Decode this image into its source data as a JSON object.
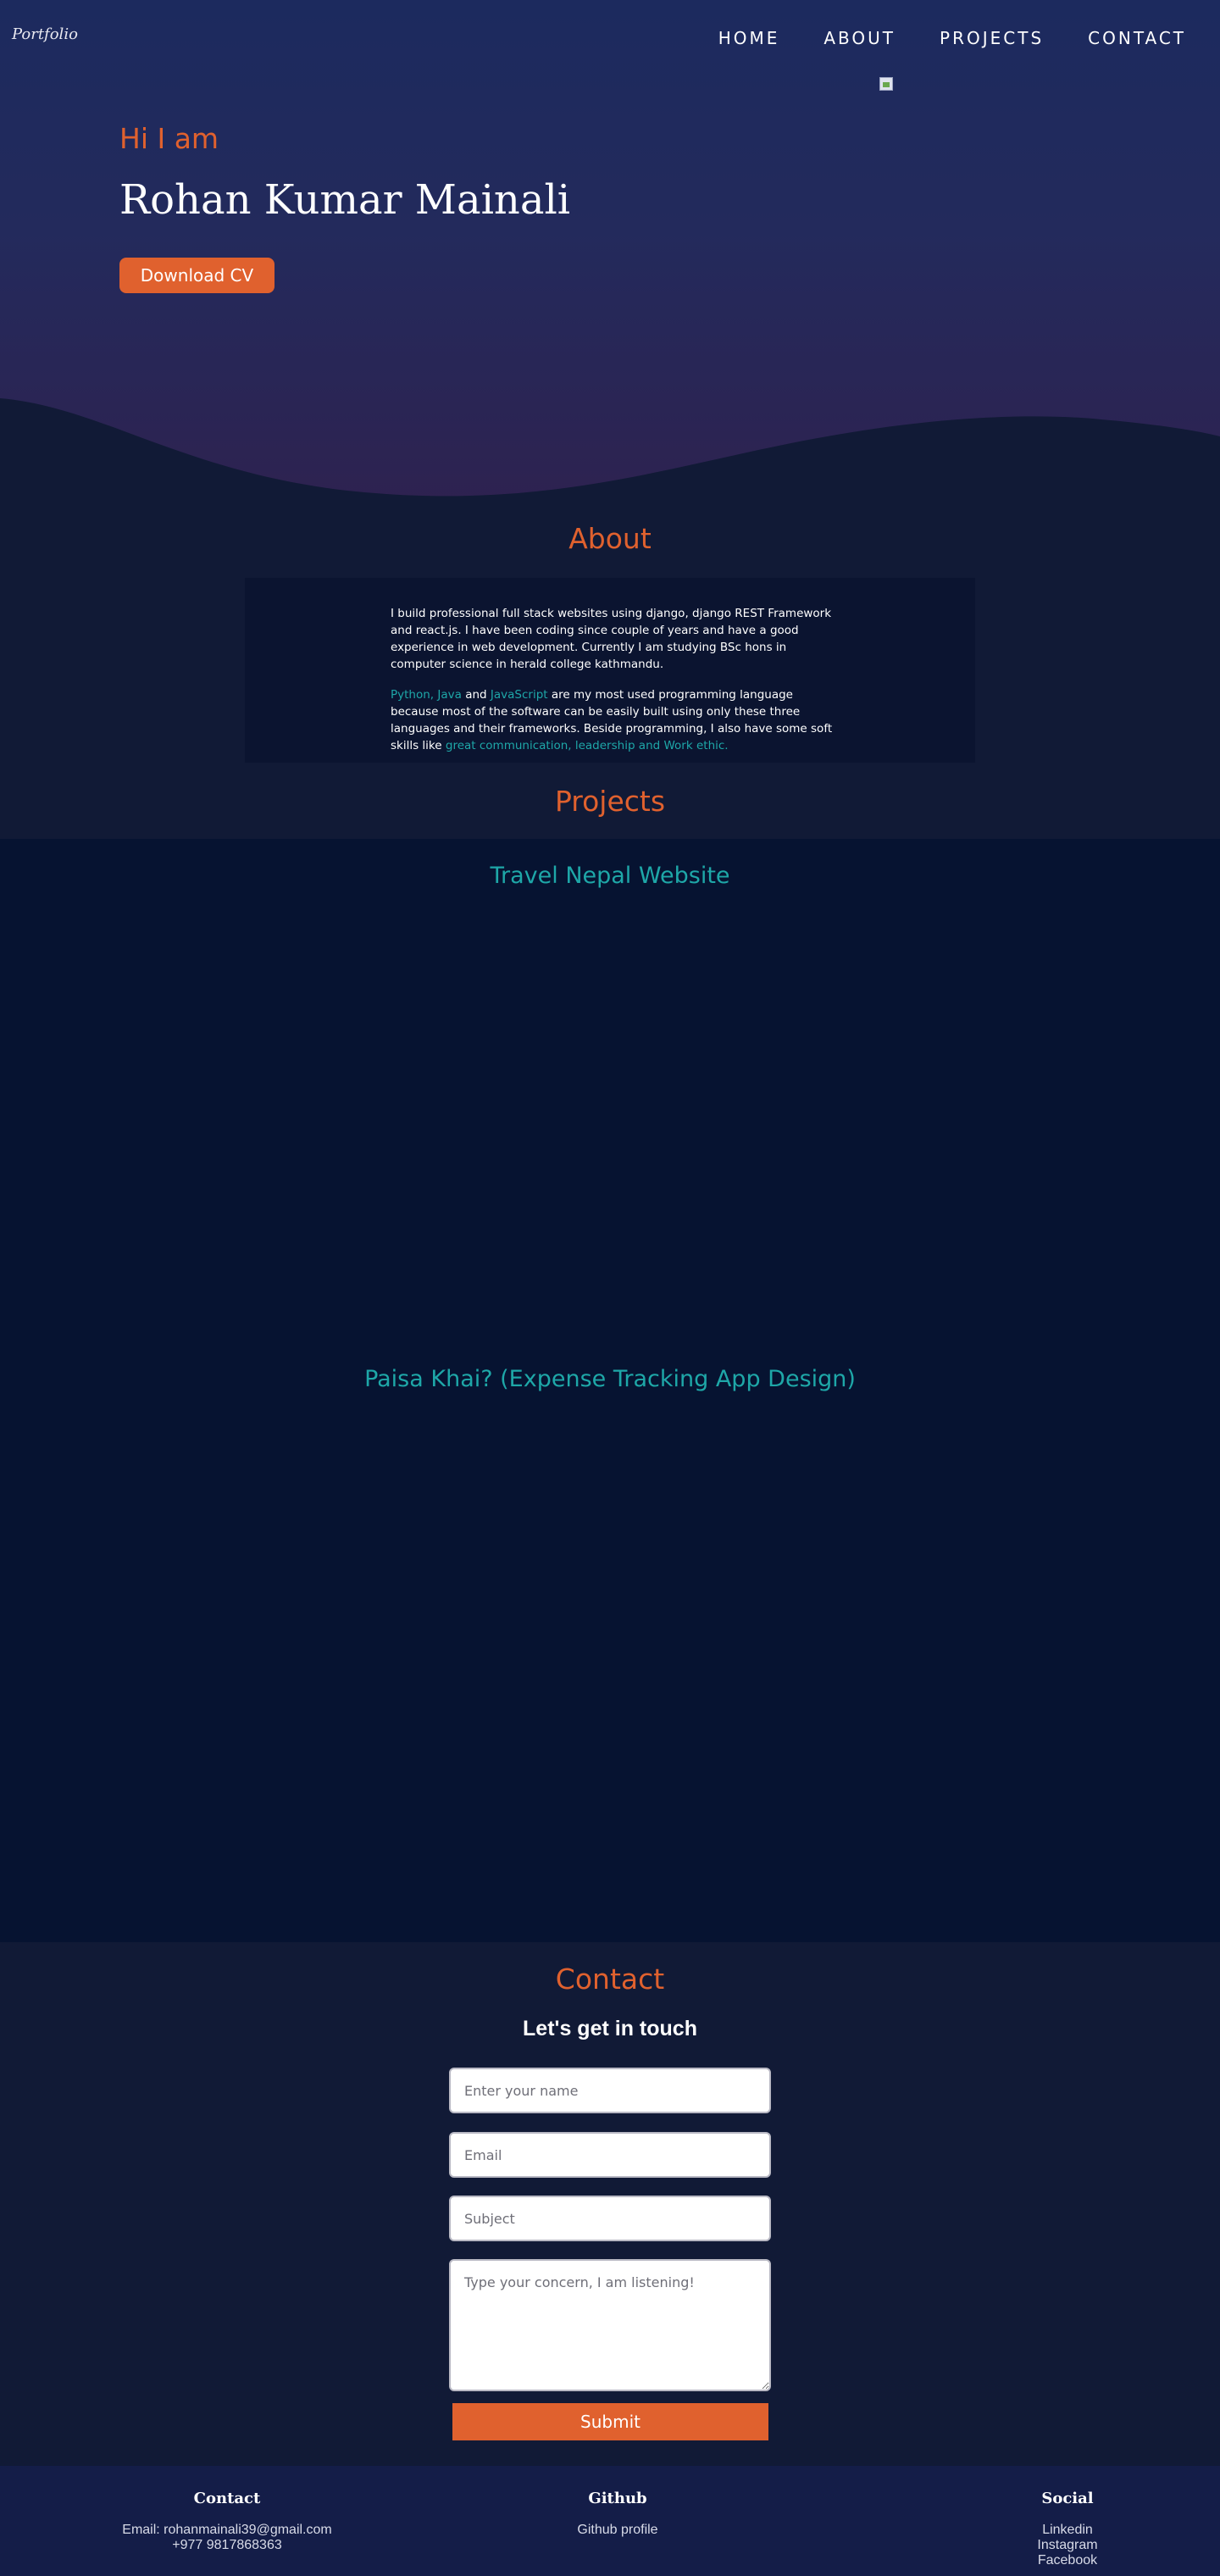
{
  "header": {
    "logo": "Portfolio",
    "nav": [
      "HOME",
      "ABOUT",
      "PROJECTS",
      "CONTACT"
    ]
  },
  "hero": {
    "greeting": "Hi I am",
    "name": "Rohan Kumar Mainali",
    "cv_button": "Download CV"
  },
  "about": {
    "title": "About",
    "paragraph1": "I build professional full stack websites using django, django REST Framework and react.js. I have been coding since couple of years and have a good experience in web development. Currently I am studying BSc hons in computer science in herald college kathmandu.",
    "p2_python_java": "Python, Java",
    "p2_and": " and ",
    "p2_js": "JavaScript",
    "p2_middle": " are my most used programming language because most of the software can be easily built using only these three languages and their frameworks. Beside programming, I also have some soft skills like ",
    "p2_skills": "great communication, leadership and Work ethic."
  },
  "projects": {
    "title": "Projects",
    "items": [
      {
        "title": "Travel Nepal Website"
      },
      {
        "title": "Paisa Khai? (Expense Tracking App Design)"
      }
    ]
  },
  "contact": {
    "title": "Contact",
    "subtitle": "Let's get in touch",
    "name_placeholder": "Enter your name",
    "email_placeholder": "Email",
    "subject_placeholder": "Subject",
    "message_placeholder": "Type your concern, I am listening!",
    "submit": "Submit"
  },
  "footer": {
    "contact": {
      "heading": "Contact",
      "email": "Email: rohanmainali39@gmail.com",
      "phone": "+977 9817868363"
    },
    "github": {
      "heading": "Github",
      "link": "Github profile"
    },
    "social": {
      "heading": "Social",
      "links": [
        "Linkedin",
        "Instagram",
        "Facebook"
      ]
    }
  },
  "colors": {
    "accent": "#e0612e",
    "teal": "#1ea7a8",
    "background": "#111a36"
  }
}
